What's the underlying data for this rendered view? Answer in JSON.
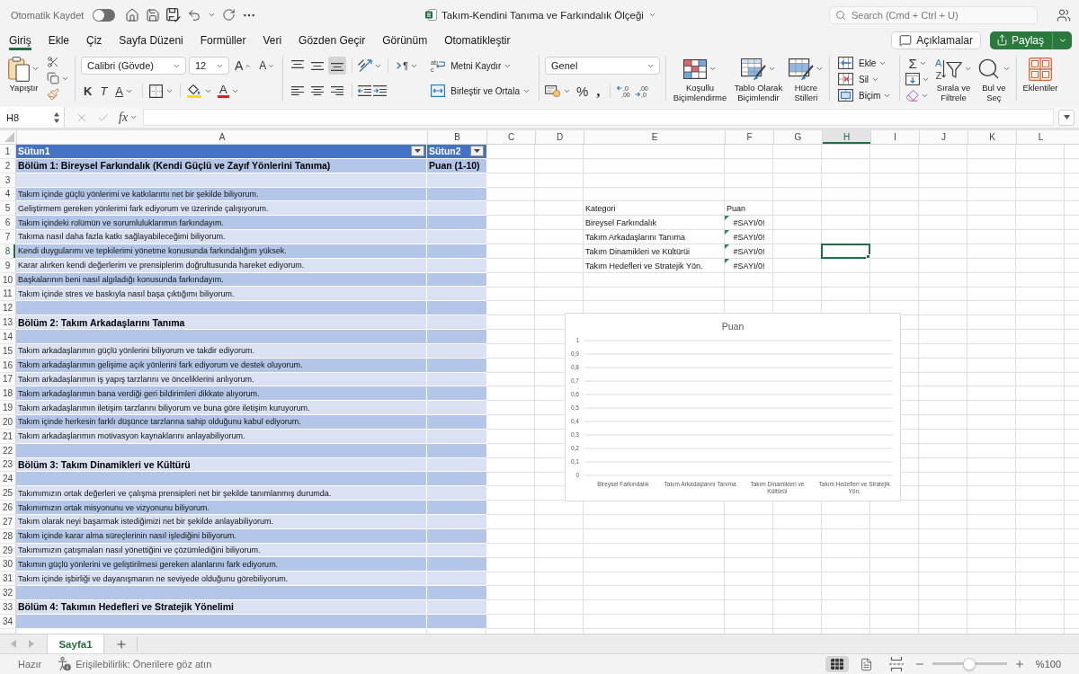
{
  "title_bar": {
    "autosave": {
      "label": "Otomatik Kaydet",
      "on": false
    },
    "document_title": "Takım-Kendini Tanıma ve Farkındalık Ölçeği",
    "search": {
      "placeholder": "Search (Cmd + Ctrl + U)"
    }
  },
  "tabs": [
    {
      "label": "Giriş",
      "selected": true
    },
    {
      "label": "Ekle",
      "selected": false
    },
    {
      "label": "Çiz",
      "selected": false
    },
    {
      "label": "Sayfa Düzeni",
      "selected": false
    },
    {
      "label": "Formüller",
      "selected": false
    },
    {
      "label": "Veri",
      "selected": false
    },
    {
      "label": "Gözden Geçir",
      "selected": false
    },
    {
      "label": "Görünüm",
      "selected": false
    },
    {
      "label": "Otomatikleştir",
      "selected": false
    }
  ],
  "actions": {
    "comments": "Açıklamalar",
    "share": "Paylaş"
  },
  "ribbon": {
    "clipboard": {
      "paste": "Yapıştır"
    },
    "font": {
      "name": "Calibri (Gövde)",
      "size": "12",
      "grow": "A",
      "shrink": "A",
      "bold": "K",
      "italic": "T",
      "underline": "A",
      "font_color": "A"
    },
    "alignment": {
      "vertical": [
        {
          "kind": "top",
          "selected": false
        },
        {
          "kind": "middle",
          "selected": false
        },
        {
          "kind": "bottom",
          "selected": true
        }
      ],
      "horizontal": [
        {
          "kind": "left",
          "selected": false
        },
        {
          "kind": "center",
          "selected": false
        },
        {
          "kind": "right",
          "selected": false
        }
      ],
      "direction": "¶",
      "wrap_icon": [
        "ab",
        "c"
      ],
      "wrap_text": "Metni Kaydır",
      "merge": "Birleştir ve Ortala"
    },
    "number": {
      "format": "Genel",
      "percent": "%",
      "comma": ",",
      "increase_decimal": [
        ",0",
        ",00"
      ],
      "decrease_decimal": [
        ",00",
        ",0"
      ]
    },
    "styles": [
      {
        "kind": "conditional",
        "label": "Koşullu Biçimlendirme"
      },
      {
        "kind": "table",
        "label": "Tablo Olarak Biçimlendir"
      },
      {
        "kind": "cell",
        "label": "Hücre Stilleri"
      }
    ],
    "cells": [
      {
        "kind": "insert",
        "label": "Ekle"
      },
      {
        "kind": "delete",
        "label": "Sil"
      },
      {
        "kind": "format",
        "label": "Biçim"
      }
    ],
    "editing": {
      "autosum": "Σ",
      "sort_icon": [
        "A",
        "Z"
      ],
      "sort_filter": "Sırala ve Filtrele",
      "find_select": "Bul ve Seç"
    },
    "add_ins": "Eklentiler"
  },
  "formula_bar": {
    "name_box": "H8",
    "function_label": "fx"
  },
  "sheet": {
    "filter_buttons": true,
    "columns": [
      {
        "label": "A",
        "selected": false
      },
      {
        "label": "B",
        "selected": false
      },
      {
        "label": "C",
        "selected": false
      },
      {
        "label": "D",
        "selected": false
      },
      {
        "label": "E",
        "selected": false
      },
      {
        "label": "F",
        "selected": false
      },
      {
        "label": "G",
        "selected": false
      },
      {
        "label": "H",
        "selected": true
      },
      {
        "label": "I",
        "selected": false
      },
      {
        "label": "J",
        "selected": false
      },
      {
        "label": "K",
        "selected": false
      },
      {
        "label": "L",
        "selected": false
      }
    ],
    "rows": [
      {
        "number": "1",
        "selected": false,
        "kind": "header",
        "a": "Sütun1",
        "b": "Sütun2"
      },
      {
        "number": "2",
        "selected": false,
        "kind": "section",
        "a": "Bölüm 1: Bireysel Farkındalık (Kendi Güçlü ve Zayıf Yönlerini Tanıma)",
        "b": "Puan (1-10)"
      },
      {
        "number": "3",
        "selected": false,
        "kind": "blank"
      },
      {
        "number": "4",
        "selected": false,
        "kind": "item",
        "a": "Takım içinde güçlü yönlerimi ve katkılarımı net bir şekilde biliyorum."
      },
      {
        "number": "5",
        "selected": false,
        "kind": "item",
        "a": "Geliştirmem gereken yönlerimi fark ediyorum ve üzerinde çalışıyorum.",
        "e": "Kategori",
        "f": {
          "text": "Puan",
          "error": false
        }
      },
      {
        "number": "6",
        "selected": false,
        "kind": "item",
        "a": "Takım içindeki rolümün ve sorumluluklarımın farkındayım.",
        "e": "Bireysel Farkındalık",
        "f": {
          "text": "#SAYI/0!",
          "error": true
        }
      },
      {
        "number": "7",
        "selected": false,
        "kind": "item",
        "a": "Takıma nasıl daha fazla katkı sağlayabileceğimi biliyorum.",
        "e": "Takım Arkadaşlarını Tanıma",
        "f": {
          "text": "#SAYI/0!",
          "error": true
        }
      },
      {
        "number": "8",
        "selected": true,
        "kind": "item",
        "a": "Kendi duygularımı ve tepkilerimi yönetme konusunda farkındalığım yüksek.",
        "e": "Takım Dinamikleri ve Kültürüi",
        "f": {
          "text": "#SAYI/0!",
          "error": true
        }
      },
      {
        "number": "9",
        "selected": false,
        "kind": "item",
        "a": "Karar alırken kendi değerlerim ve prensiplerim doğrultusunda hareket ediyorum.",
        "e": "Takım Hedefleri ve Stratejik Yön.",
        "f": {
          "text": "#SAYI/0!",
          "error": true
        }
      },
      {
        "number": "10",
        "selected": false,
        "kind": "item",
        "a": "Başkalarının beni nasıl algıladığı konusunda farkındayım."
      },
      {
        "number": "11",
        "selected": false,
        "kind": "item",
        "a": "Takım içinde stres ve baskıyla nasıl başa çıktığımı biliyorum."
      },
      {
        "number": "12",
        "selected": false,
        "kind": "blank"
      },
      {
        "number": "13",
        "selected": false,
        "kind": "section",
        "a": "Bölüm 2: Takım Arkadaşlarını Tanıma"
      },
      {
        "number": "14",
        "selected": false,
        "kind": "blank"
      },
      {
        "number": "15",
        "selected": false,
        "kind": "item",
        "a": "Takım arkadaşlarımın güçlü yönlerini biliyorum ve takdir ediyorum."
      },
      {
        "number": "16",
        "selected": false,
        "kind": "item",
        "a": "Takım arkadaşlarımın gelişime açık yönlerini fark ediyorum ve destek oluyorum."
      },
      {
        "number": "17",
        "selected": false,
        "kind": "item",
        "a": "Takım arkadaşlarımın iş yapış tarzlarını ve önceliklerini anlıyorum."
      },
      {
        "number": "18",
        "selected": false,
        "kind": "item",
        "a": "Takım arkadaşlarımın bana verdiği geri bildirimleri dikkate alıyorum."
      },
      {
        "number": "19",
        "selected": false,
        "kind": "item",
        "a": "Takım arkadaşlarımın iletişim tarzlarını biliyorum ve buna göre iletişim kuruyorum."
      },
      {
        "number": "20",
        "selected": false,
        "kind": "item",
        "a": "Takım içinde herkesin farklı düşünce tarzlarına sahip olduğunu kabul ediyorum."
      },
      {
        "number": "21",
        "selected": false,
        "kind": "item",
        "a": "Takım arkadaşlarımın motivasyon kaynaklarını anlayabiliyorum."
      },
      {
        "number": "22",
        "selected": false,
        "kind": "blank"
      },
      {
        "number": "23",
        "selected": false,
        "kind": "section",
        "a": "Bölüm 3: Takım Dinamikleri ve Kültürü"
      },
      {
        "number": "24",
        "selected": false,
        "kind": "blank"
      },
      {
        "number": "25",
        "selected": false,
        "kind": "item",
        "a": "Takımımızın ortak değerleri ve çalışma prensipleri net bir şekilde tanımlanmış durumda."
      },
      {
        "number": "26",
        "selected": false,
        "kind": "item",
        "a": "Takımımızın ortak misyonunu ve vizyonunu biliyorum."
      },
      {
        "number": "27",
        "selected": false,
        "kind": "item",
        "a": "Takım olarak neyi başarmak istediğimizi net bir şekilde anlayabiliyorum."
      },
      {
        "number": "28",
        "selected": false,
        "kind": "item",
        "a": "Takım içinde karar alma süreçlerinin nasıl işlediğini biliyorum."
      },
      {
        "number": "29",
        "selected": false,
        "kind": "item",
        "a": "Takımımızın çatışmaları nasıl yönettiğini ve çözümlediğini biliyorum."
      },
      {
        "number": "30",
        "selected": false,
        "kind": "item",
        "a": "Takımın güçlü yönlerini ve geliştirilmesi gereken alanlarını fark ediyorum."
      },
      {
        "number": "31",
        "selected": false,
        "kind": "item",
        "a": "Takım içinde işbirliği ve dayanışmanın ne seviyede olduğunu görebiliyorum."
      },
      {
        "number": "32",
        "selected": false,
        "kind": "blank"
      },
      {
        "number": "33",
        "selected": false,
        "kind": "section",
        "a": "Bölüm 4: Takımın Hedefleri ve Stratejik Yönelimi"
      },
      {
        "number": "34",
        "selected": false,
        "kind": "blank"
      }
    ]
  },
  "chart": {
    "chart_data": {
      "type": "bar",
      "title": "Puan",
      "categories": [
        "Bireysel Farkındalık",
        "Takım Arkadaşlarını Tanıma",
        "Takım Dinamikleri ve Kültürüi",
        "Takım Hedefleri ve Stratejik Yön."
      ],
      "values": [
        null,
        null,
        null,
        null
      ],
      "ylim": [
        0,
        1
      ],
      "yticks": [
        0,
        {
          "value": 0.1,
          "label": "0,1"
        },
        {
          "value": 0.2,
          "label": "0,2"
        },
        {
          "value": 0.3,
          "label": "0,3"
        },
        {
          "value": 0.4,
          "label": "0,4"
        },
        {
          "value": 0.5,
          "label": "0,5"
        },
        {
          "value": 0.6,
          "label": "0,6"
        },
        {
          "value": 0.7,
          "label": "0,7"
        },
        {
          "value": 0.8,
          "label": "0,8"
        },
        {
          "value": 0.9,
          "label": "0,9"
        },
        1
      ],
      "grid": true
    }
  },
  "sheet_tabs": [
    {
      "label": "Sayfa1",
      "selected": true
    }
  ],
  "status_bar": {
    "status": "Hazır",
    "accessibility": "Erişilebilirlik: Önerilere göz atın",
    "views": [
      {
        "kind": "normal",
        "selected": true
      },
      {
        "kind": "page_layout",
        "selected": false
      },
      {
        "kind": "page_break",
        "selected": false
      }
    ],
    "zoom": {
      "level": 0.5,
      "reading": "%100"
    }
  }
}
